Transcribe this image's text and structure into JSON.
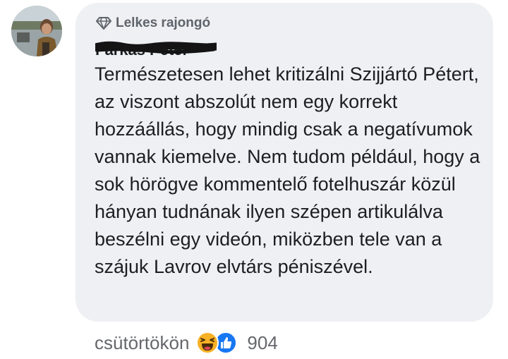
{
  "comment": {
    "badge": {
      "icon": "diamond-icon",
      "label": "Lelkes rajongó"
    },
    "author": {
      "name": "Farkas Péter",
      "redacted": true
    },
    "text": "Természetesen lehet kritizálni Szijjártó Pétert, az viszont abszolút nem egy korrekt hozzáállás, hogy mindig csak a negatívumok vannak kiemelve. Nem tudom például, hogy a sok hörögve kommentelő fotelhuszár közül hányan tudnának ilyen szépen artikulálva beszélni egy videón, miközben tele van a szájuk Lavrov elvtárs péniszével.",
    "footer": {
      "timestamp": "csütörtökön",
      "reactions": [
        "haha-icon",
        "like-icon"
      ],
      "reaction_count": "904"
    }
  },
  "colors": {
    "bubble": "#eef0f3",
    "text": "#1c1e21",
    "secondary": "#65676b",
    "like_blue": "#1877f2",
    "haha_yellow": "#f7b125"
  }
}
